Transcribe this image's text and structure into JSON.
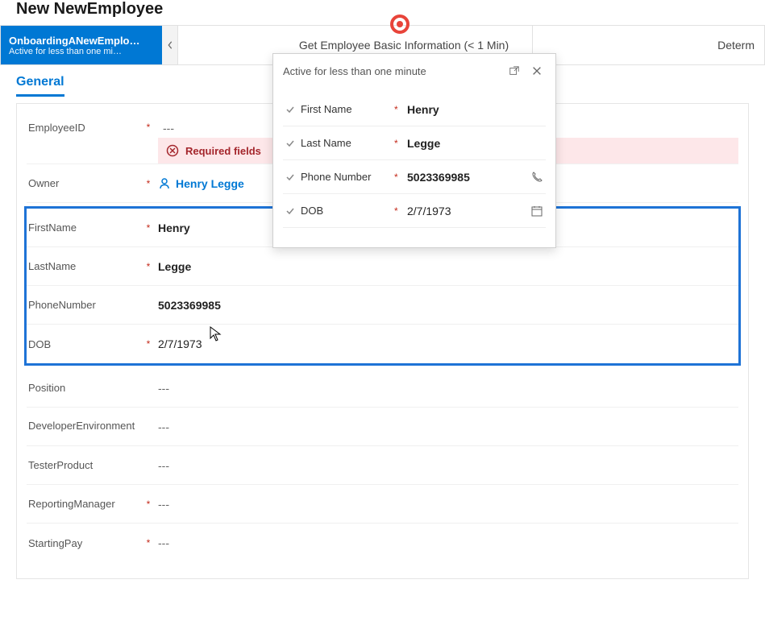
{
  "page": {
    "title": "New NewEmployee"
  },
  "stages": {
    "active": {
      "title": "OnboardingANewEmplo…",
      "subtitle": "Active for less than one mi…"
    },
    "middle": "Get Employee Basic Information  (< 1 Min)",
    "last": "Determ"
  },
  "tabs": {
    "general": "General"
  },
  "flyout": {
    "title": "Active for less than one minute",
    "fields": {
      "firstName": {
        "label": "First Name",
        "value": "Henry",
        "required": true
      },
      "lastName": {
        "label": "Last Name",
        "value": "Legge",
        "required": true
      },
      "phone": {
        "label": "Phone Number",
        "value": "5023369985",
        "required": true
      },
      "dob": {
        "label": "DOB",
        "value": "2/7/1973",
        "required": true
      }
    }
  },
  "form": {
    "employeeId": {
      "label": "EmployeeID",
      "value": "---",
      "required": true,
      "error": "Required fields"
    },
    "owner": {
      "label": "Owner",
      "value": "Henry Legge",
      "required": true
    },
    "firstName": {
      "label": "FirstName",
      "value": "Henry",
      "required": true
    },
    "lastName": {
      "label": "LastName",
      "value": "Legge",
      "required": true
    },
    "phone": {
      "label": "PhoneNumber",
      "value": "5023369985",
      "required": false
    },
    "dob": {
      "label": "DOB",
      "value": "2/7/1973",
      "required": true
    },
    "position": {
      "label": "Position",
      "value": "---",
      "required": false
    },
    "devEnv": {
      "label": "DeveloperEnvironment",
      "value": "---",
      "required": false
    },
    "tester": {
      "label": "TesterProduct",
      "value": "---",
      "required": false
    },
    "manager": {
      "label": "ReportingManager",
      "value": "---",
      "required": true
    },
    "pay": {
      "label": "StartingPay",
      "value": "---",
      "required": true
    }
  }
}
